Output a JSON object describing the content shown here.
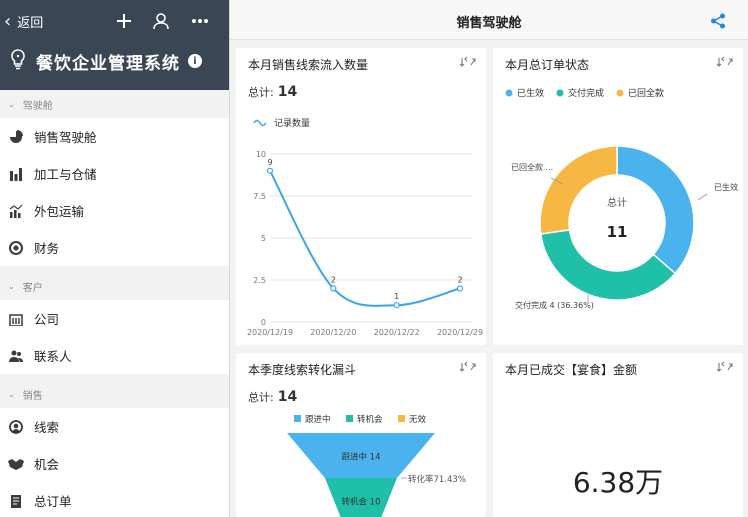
{
  "sidebar": {
    "back_label": "返回",
    "app_title": "餐饮企业管理系统",
    "groups": [
      {
        "title": "驾驶舱",
        "items": [
          {
            "label": "销售驾驶舱",
            "icon": "pie-icon"
          },
          {
            "label": "加工与仓储",
            "icon": "bar-icon"
          },
          {
            "label": "外包运输",
            "icon": "bar-line-icon"
          },
          {
            "label": "财务",
            "icon": "finance-icon"
          }
        ]
      },
      {
        "title": "客户",
        "items": [
          {
            "label": "公司",
            "icon": "building-icon"
          },
          {
            "label": "联系人",
            "icon": "contacts-icon"
          }
        ]
      },
      {
        "title": "销售",
        "items": [
          {
            "label": "线索",
            "icon": "lead-icon"
          },
          {
            "label": "机会",
            "icon": "handshake-icon"
          },
          {
            "label": "总订单",
            "icon": "order-icon"
          }
        ]
      }
    ]
  },
  "header": {
    "title": "销售驾驶舱"
  },
  "cards": {
    "leads": {
      "title": "本月销售线索流入数量",
      "total_label": "总计:",
      "total_value": "14",
      "legend": "记录数量"
    },
    "orders": {
      "title": "本月总订单状态",
      "center_label": "总计",
      "center_value": "11"
    },
    "funnel": {
      "title": "本季度线索转化漏斗",
      "total_label": "总计:",
      "total_value": "14"
    },
    "amount": {
      "title": "本月已成交【宴食】金额",
      "value": "6.38万"
    }
  },
  "chart_data": [
    {
      "type": "line",
      "title": "本月销售线索流入数量",
      "categories": [
        "2020/12/19",
        "2020/12/20",
        "2020/12/22",
        "2020/12/29"
      ],
      "series": [
        {
          "name": "记录数量",
          "values": [
            9,
            2,
            1,
            2
          ]
        }
      ],
      "ylim": [
        0,
        10
      ],
      "yticks": [
        "0",
        "2.5",
        "5",
        "7.5",
        "10"
      ],
      "color": "#3aa6e8",
      "grid": true
    },
    {
      "type": "pie",
      "title": "本月总订单状态",
      "legend": [
        "已生效",
        "交付完成",
        "已回全款"
      ],
      "legend_colors": [
        "#4ab3ee",
        "#1fbfa8",
        "#f7b843"
      ],
      "slices": [
        {
          "label": "已生效",
          "value": 4,
          "color": "#4ab3ee",
          "callout": "已生效"
        },
        {
          "label": "交付完成",
          "value": 4,
          "color": "#1fbfa8",
          "callout": "交付完成  4 (36.36%)"
        },
        {
          "label": "已回全款",
          "value": 3,
          "color": "#f7b843",
          "callout": "已回全款  ..."
        }
      ]
    },
    {
      "type": "funnel",
      "title": "本季度线索转化漏斗",
      "legend": [
        "跟进中",
        "转机会",
        "无效"
      ],
      "legend_colors": [
        "#4ab3ee",
        "#1fbfa8",
        "#f7b843"
      ],
      "stages": [
        {
          "label": "跟进中 14",
          "value": 14,
          "color": "#4ab3ee"
        },
        {
          "label": "转机会 10",
          "value": 10,
          "color": "#1fbfa8"
        }
      ],
      "conversion_label": "转化率71.43%"
    }
  ]
}
